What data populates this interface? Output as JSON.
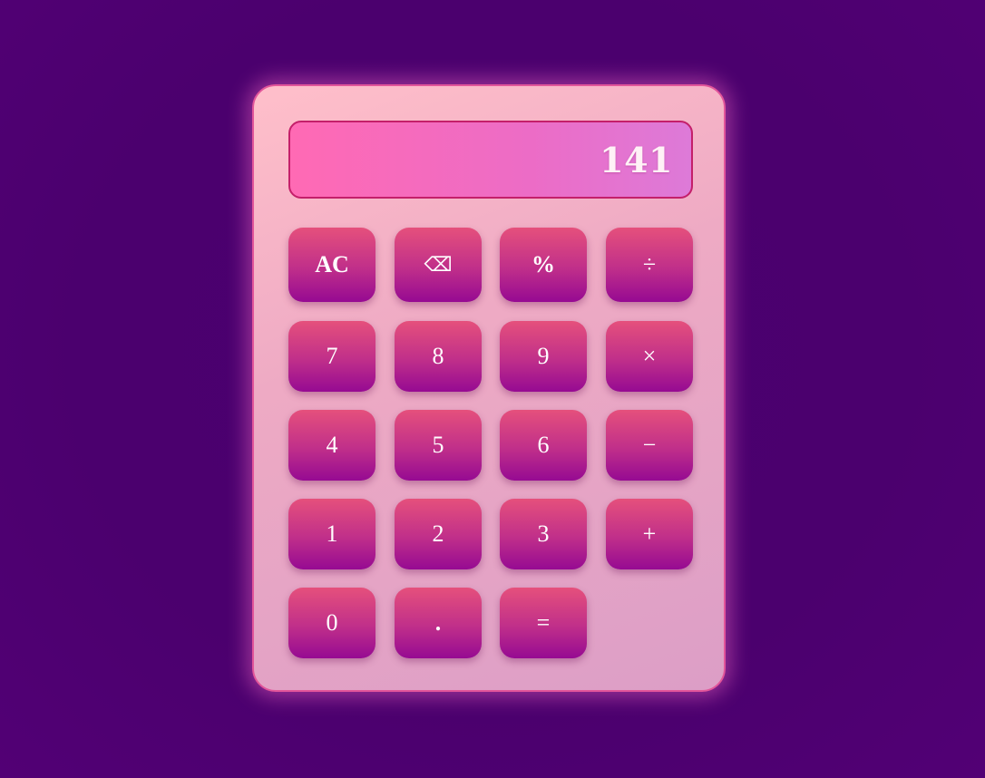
{
  "display": {
    "value": "141"
  },
  "keys": {
    "clear": "AC",
    "backspace": "⌫",
    "percent": "%",
    "divide": "÷",
    "seven": "7",
    "eight": "8",
    "nine": "9",
    "multiply": "×",
    "four": "4",
    "five": "5",
    "six": "6",
    "subtract": "−",
    "one": "1",
    "two": "2",
    "three": "3",
    "add": "+",
    "zero": "0",
    "decimal": ".",
    "equals": "="
  },
  "colors": {
    "background": "#4b006e",
    "body_top": "#ffbfca",
    "body_bottom": "#dc9ec6",
    "display_left": "#ff6ab4",
    "display_right": "#dd7ad8",
    "key_top": "#e5507c",
    "key_bottom": "#960a92",
    "text": "#ffffff"
  }
}
